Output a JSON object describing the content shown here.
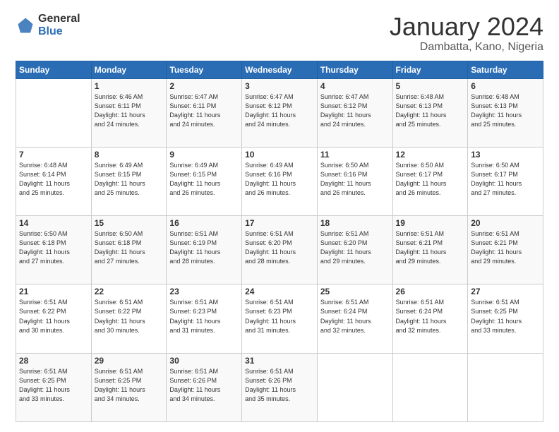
{
  "header": {
    "logo_general": "General",
    "logo_blue": "Blue",
    "month_title": "January 2024",
    "location": "Dambatta, Kano, Nigeria"
  },
  "days_of_week": [
    "Sunday",
    "Monday",
    "Tuesday",
    "Wednesday",
    "Thursday",
    "Friday",
    "Saturday"
  ],
  "weeks": [
    [
      {
        "day": "",
        "info": ""
      },
      {
        "day": "1",
        "info": "Sunrise: 6:46 AM\nSunset: 6:11 PM\nDaylight: 11 hours\nand 24 minutes."
      },
      {
        "day": "2",
        "info": "Sunrise: 6:47 AM\nSunset: 6:11 PM\nDaylight: 11 hours\nand 24 minutes."
      },
      {
        "day": "3",
        "info": "Sunrise: 6:47 AM\nSunset: 6:12 PM\nDaylight: 11 hours\nand 24 minutes."
      },
      {
        "day": "4",
        "info": "Sunrise: 6:47 AM\nSunset: 6:12 PM\nDaylight: 11 hours\nand 24 minutes."
      },
      {
        "day": "5",
        "info": "Sunrise: 6:48 AM\nSunset: 6:13 PM\nDaylight: 11 hours\nand 25 minutes."
      },
      {
        "day": "6",
        "info": "Sunrise: 6:48 AM\nSunset: 6:13 PM\nDaylight: 11 hours\nand 25 minutes."
      }
    ],
    [
      {
        "day": "7",
        "info": ""
      },
      {
        "day": "8",
        "info": "Sunrise: 6:49 AM\nSunset: 6:15 PM\nDaylight: 11 hours\nand 25 minutes."
      },
      {
        "day": "9",
        "info": "Sunrise: 6:49 AM\nSunset: 6:15 PM\nDaylight: 11 hours\nand 26 minutes."
      },
      {
        "day": "10",
        "info": "Sunrise: 6:49 AM\nSunset: 6:16 PM\nDaylight: 11 hours\nand 26 minutes."
      },
      {
        "day": "11",
        "info": "Sunrise: 6:50 AM\nSunset: 6:16 PM\nDaylight: 11 hours\nand 26 minutes."
      },
      {
        "day": "12",
        "info": "Sunrise: 6:50 AM\nSunset: 6:17 PM\nDaylight: 11 hours\nand 26 minutes."
      },
      {
        "day": "13",
        "info": "Sunrise: 6:50 AM\nSunset: 6:17 PM\nDaylight: 11 hours\nand 27 minutes."
      }
    ],
    [
      {
        "day": "14",
        "info": ""
      },
      {
        "day": "15",
        "info": "Sunrise: 6:50 AM\nSunset: 6:18 PM\nDaylight: 11 hours\nand 27 minutes."
      },
      {
        "day": "16",
        "info": "Sunrise: 6:51 AM\nSunset: 6:19 PM\nDaylight: 11 hours\nand 28 minutes."
      },
      {
        "day": "17",
        "info": "Sunrise: 6:51 AM\nSunset: 6:20 PM\nDaylight: 11 hours\nand 28 minutes."
      },
      {
        "day": "18",
        "info": "Sunrise: 6:51 AM\nSunset: 6:20 PM\nDaylight: 11 hours\nand 29 minutes."
      },
      {
        "day": "19",
        "info": "Sunrise: 6:51 AM\nSunset: 6:21 PM\nDaylight: 11 hours\nand 29 minutes."
      },
      {
        "day": "20",
        "info": "Sunrise: 6:51 AM\nSunset: 6:21 PM\nDaylight: 11 hours\nand 29 minutes."
      }
    ],
    [
      {
        "day": "21",
        "info": ""
      },
      {
        "day": "22",
        "info": "Sunrise: 6:51 AM\nSunset: 6:22 PM\nDaylight: 11 hours\nand 30 minutes."
      },
      {
        "day": "23",
        "info": "Sunrise: 6:51 AM\nSunset: 6:23 PM\nDaylight: 11 hours\nand 31 minutes."
      },
      {
        "day": "24",
        "info": "Sunrise: 6:51 AM\nSunset: 6:23 PM\nDaylight: 11 hours\nand 31 minutes."
      },
      {
        "day": "25",
        "info": "Sunrise: 6:51 AM\nSunset: 6:24 PM\nDaylight: 11 hours\nand 32 minutes."
      },
      {
        "day": "26",
        "info": "Sunrise: 6:51 AM\nSunset: 6:24 PM\nDaylight: 11 hours\nand 32 minutes."
      },
      {
        "day": "27",
        "info": "Sunrise: 6:51 AM\nSunset: 6:25 PM\nDaylight: 11 hours\nand 33 minutes."
      }
    ],
    [
      {
        "day": "28",
        "info": ""
      },
      {
        "day": "29",
        "info": "Sunrise: 6:51 AM\nSunset: 6:25 PM\nDaylight: 11 hours\nand 34 minutes."
      },
      {
        "day": "30",
        "info": "Sunrise: 6:51 AM\nSunset: 6:26 PM\nDaylight: 11 hours\nand 34 minutes."
      },
      {
        "day": "31",
        "info": "Sunrise: 6:51 AM\nSunset: 6:26 PM\nDaylight: 11 hours\nand 35 minutes."
      },
      {
        "day": "",
        "info": ""
      },
      {
        "day": "",
        "info": ""
      },
      {
        "day": "",
        "info": ""
      }
    ]
  ],
  "week1_day7_info": "Sunrise: 6:48 AM\nSunset: 6:14 PM\nDaylight: 11 hours\nand 25 minutes.",
  "week2_day14_info": "Sunrise: 6:50 AM\nSunset: 6:18 PM\nDaylight: 11 hours\nand 27 minutes.",
  "week3_day21_info": "Sunrise: 6:51 AM\nSunset: 6:22 PM\nDaylight: 11 hours\nand 30 minutes.",
  "week4_day28_info": "Sunrise: 6:51 AM\nSunset: 6:25 PM\nDaylight: 11 hours\nand 33 minutes."
}
